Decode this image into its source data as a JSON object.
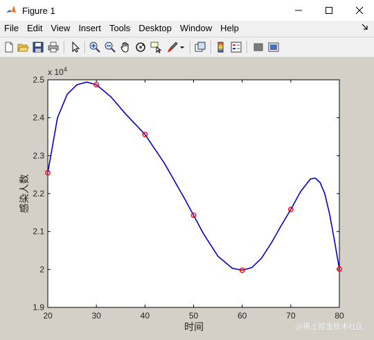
{
  "window": {
    "title": "Figure 1"
  },
  "menu": [
    "File",
    "Edit",
    "View",
    "Insert",
    "Tools",
    "Desktop",
    "Window",
    "Help"
  ],
  "toolbar_icons": [
    "new-figure-icon",
    "open-file-icon",
    "save-icon",
    "print-icon",
    "edit-plot-icon",
    "zoom-in-icon",
    "zoom-out-icon",
    "pan-icon",
    "rotate-3d-icon",
    "data-cursor-icon",
    "brush-icon",
    "brush-dropdown-icon",
    "link-plot-icon",
    "colorbar-icon",
    "legend-icon",
    "hide-plot-tools-icon",
    "show-plot-tools-icon"
  ],
  "chart_data": {
    "type": "line",
    "xlabel": "时间",
    "ylabel": "感染人数",
    "exponent_label": "x 10",
    "exponent_power": "4",
    "xlim": [
      20,
      80
    ],
    "ylim": [
      1.9,
      2.5
    ],
    "xticks": [
      20,
      30,
      40,
      50,
      60,
      70,
      80
    ],
    "yticks": [
      1.9,
      2.0,
      2.1,
      2.2,
      2.3,
      2.4,
      2.5
    ],
    "ytick_labels": [
      "1.9",
      "2",
      "2.1",
      "2.2",
      "2.3",
      "2.4",
      "2.5"
    ],
    "y_scale": "x 10^4",
    "series": [
      {
        "marker": "circle",
        "color": "#ff0000",
        "x": [
          20,
          30,
          40,
          50,
          60,
          70,
          80
        ],
        "values": [
          2.255,
          2.487,
          2.356,
          2.143,
          1.998,
          2.158,
          2.001
        ]
      },
      {
        "line": "solid",
        "color": "#0000cc",
        "x": [
          20,
          22,
          24,
          26,
          28,
          30,
          33,
          36,
          40,
          44,
          48,
          50,
          52,
          55,
          58,
          60,
          62,
          64,
          66,
          68,
          70,
          72,
          74,
          75,
          76,
          77,
          78,
          79,
          80
        ],
        "values": [
          2.255,
          2.4,
          2.462,
          2.487,
          2.494,
          2.487,
          2.455,
          2.41,
          2.356,
          2.28,
          2.19,
          2.143,
          2.095,
          2.035,
          2.003,
          1.998,
          2.005,
          2.03,
          2.07,
          2.115,
          2.158,
          2.205,
          2.238,
          2.241,
          2.23,
          2.2,
          2.145,
          2.075,
          2.001
        ]
      }
    ]
  },
  "watermark": "@稀土掘金技术社区"
}
